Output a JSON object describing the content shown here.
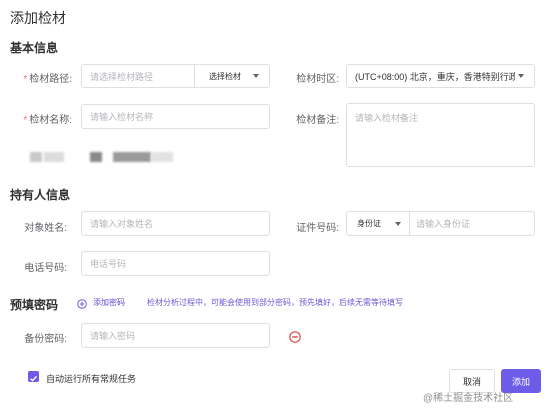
{
  "dialog": {
    "title": "添加检材"
  },
  "basic": {
    "section_title": "基本信息",
    "path_label": "检材路径:",
    "path_placeholder": "请选择检材路径",
    "path_select": "选择检材",
    "timezone_label": "检材时区:",
    "timezone_value": "(UTC+08:00) 北京，重庆，香港特别行政区",
    "name_label": "检材名称:",
    "name_placeholder": "请输入检材名称",
    "note_label": "检材备注:",
    "note_placeholder": "请输入检材备注"
  },
  "holder": {
    "section_title": "持有人信息",
    "name_label": "对象姓名:",
    "name_placeholder": "请输入对象姓名",
    "id_label": "证件号码:",
    "id_type": "身份证",
    "id_placeholder": "请输入身份证",
    "phone_label": "电话号码:",
    "phone_placeholder": "电话号码"
  },
  "password": {
    "section_title": "预填密码",
    "add_label": "添加密码",
    "hint": "检材分析过程中，可能会使用到部分密码，预先填好，后续无需等待填写",
    "backup_label": "备份密码:",
    "backup_placeholder": "请输入密码"
  },
  "footer": {
    "auto_run_label": "自动运行所有常规任务",
    "auto_run_checked": true,
    "cancel_label": "取消",
    "add_label": "添加",
    "watermark": "@稀土掘金技术社区"
  },
  "colors": {
    "primary": "#6c5ce7",
    "danger": "#f56c6c",
    "required": "#f56c6c"
  }
}
